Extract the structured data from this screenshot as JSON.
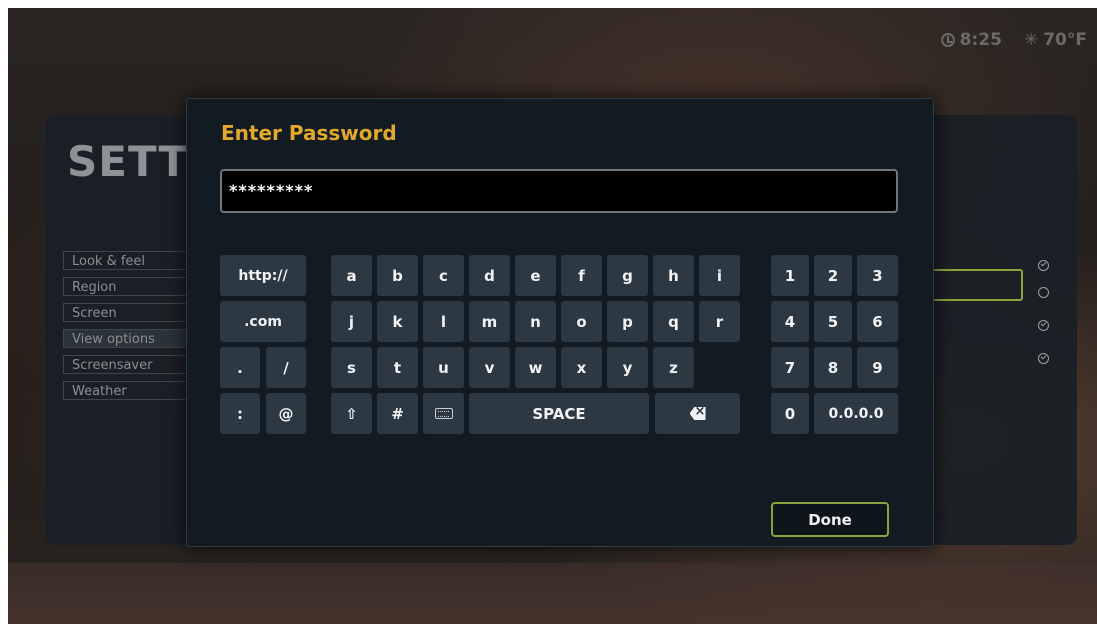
{
  "status_bar": {
    "time": "8:25",
    "temperature": "70°F"
  },
  "settings": {
    "title": "SETT",
    "menu": [
      {
        "label": "Look & feel"
      },
      {
        "label": "Region"
      },
      {
        "label": "Screen"
      },
      {
        "label": "View options"
      },
      {
        "label": "Screensaver"
      },
      {
        "label": "Weather"
      }
    ]
  },
  "dialog": {
    "title": "Enter Password",
    "password_value": "*********",
    "done_label": "Done"
  },
  "keyboard": {
    "special": {
      "http": "http://",
      "com": ".com",
      "dot": ".",
      "slash": "/",
      "colon": ":",
      "at": "@"
    },
    "row1": [
      "a",
      "b",
      "c",
      "d",
      "e",
      "f",
      "g",
      "h",
      "i"
    ],
    "row2": [
      "j",
      "k",
      "l",
      "m",
      "n",
      "o",
      "p",
      "q",
      "r"
    ],
    "row3": [
      "s",
      "t",
      "u",
      "v",
      "w",
      "x",
      "y",
      "z"
    ],
    "row4": {
      "hash": "#",
      "space": "SPACE"
    },
    "numpad": [
      "1",
      "2",
      "3",
      "4",
      "5",
      "6",
      "7",
      "8",
      "9",
      "0",
      "0.0.0.0"
    ]
  },
  "icons": {
    "clock": "clock-icon",
    "weather": "sun-icon",
    "shift": "shift-icon",
    "keyboard": "keyboard-icon",
    "backspace": "backspace-icon"
  }
}
